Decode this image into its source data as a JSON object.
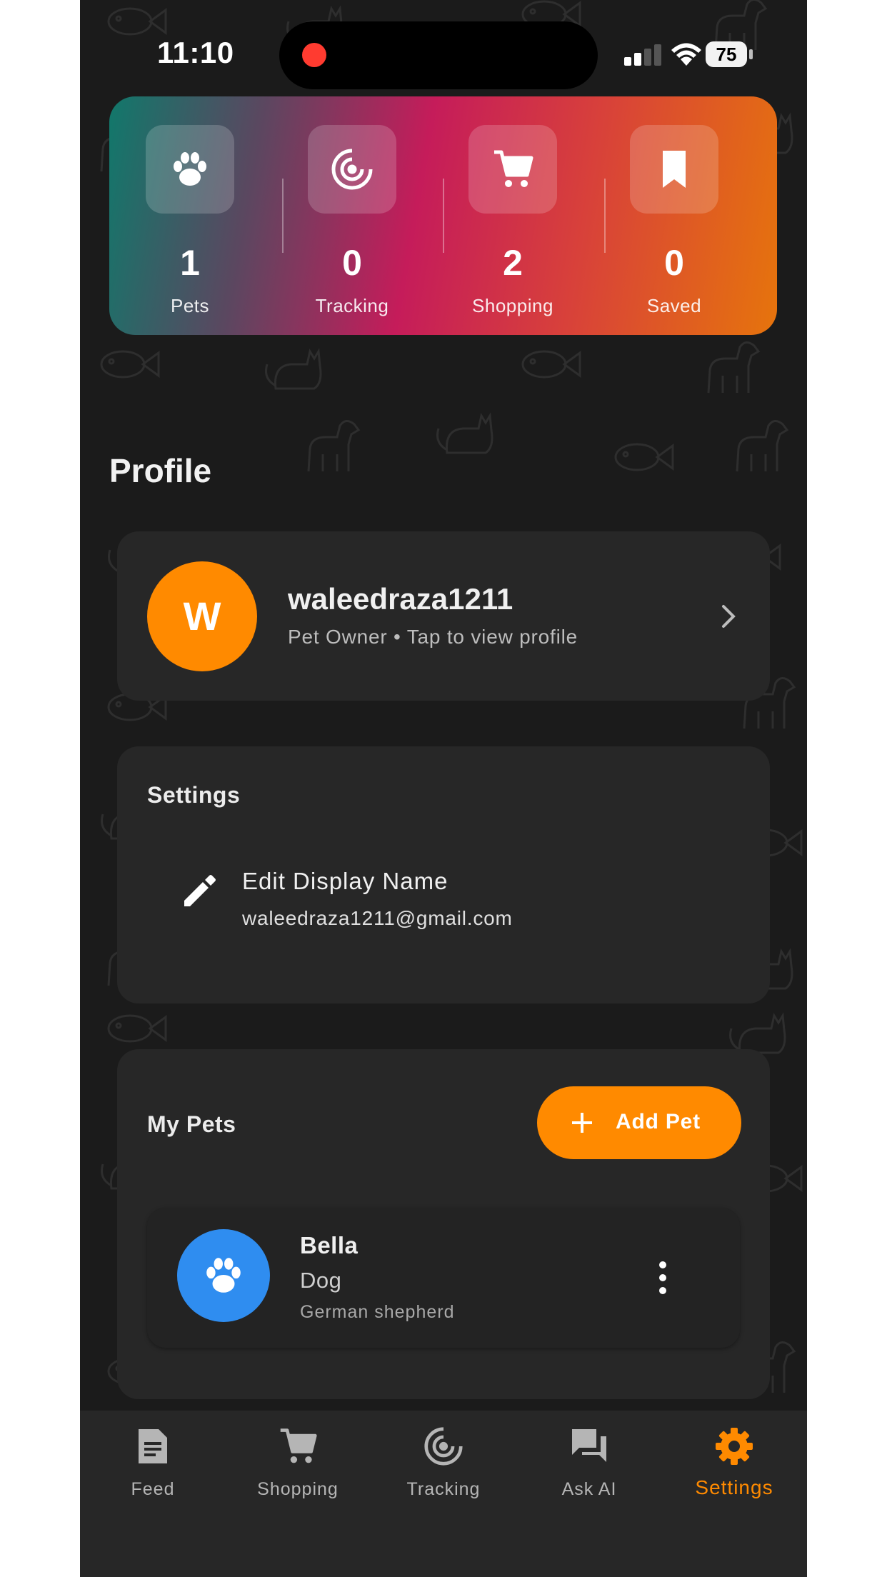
{
  "status_bar": {
    "time": "11:10",
    "battery": "75"
  },
  "stats": [
    {
      "value": "1",
      "label": "Pets",
      "icon": "paw-icon"
    },
    {
      "value": "0",
      "label": "Tracking",
      "icon": "radar-icon"
    },
    {
      "value": "2",
      "label": "Shopping",
      "icon": "cart-icon"
    },
    {
      "value": "0",
      "label": "Saved",
      "icon": "bookmark-icon"
    }
  ],
  "page_title": "Profile",
  "profile": {
    "initial": "W",
    "username": "waleedraza1211",
    "subtitle": "Pet Owner • Tap to view profile"
  },
  "settings": {
    "header": "Settings",
    "edit_title": "Edit Display Name",
    "email": "waleedraza1211@gmail.com"
  },
  "pets": {
    "header": "My Pets",
    "add_label": "Add Pet",
    "items": [
      {
        "name": "Bella",
        "type": "Dog",
        "breed": "German shepherd"
      }
    ]
  },
  "nav": [
    {
      "label": "Feed",
      "icon": "document-icon"
    },
    {
      "label": "Shopping",
      "icon": "cart-icon"
    },
    {
      "label": "Tracking",
      "icon": "radar-icon"
    },
    {
      "label": "Ask AI",
      "icon": "chat-icon"
    },
    {
      "label": "Settings",
      "icon": "gear-icon",
      "active": true
    }
  ],
  "colors": {
    "background": "#1b1b1b",
    "card": "#272727",
    "accent": "#ff8a00",
    "pet_avatar": "#2f8df0"
  }
}
